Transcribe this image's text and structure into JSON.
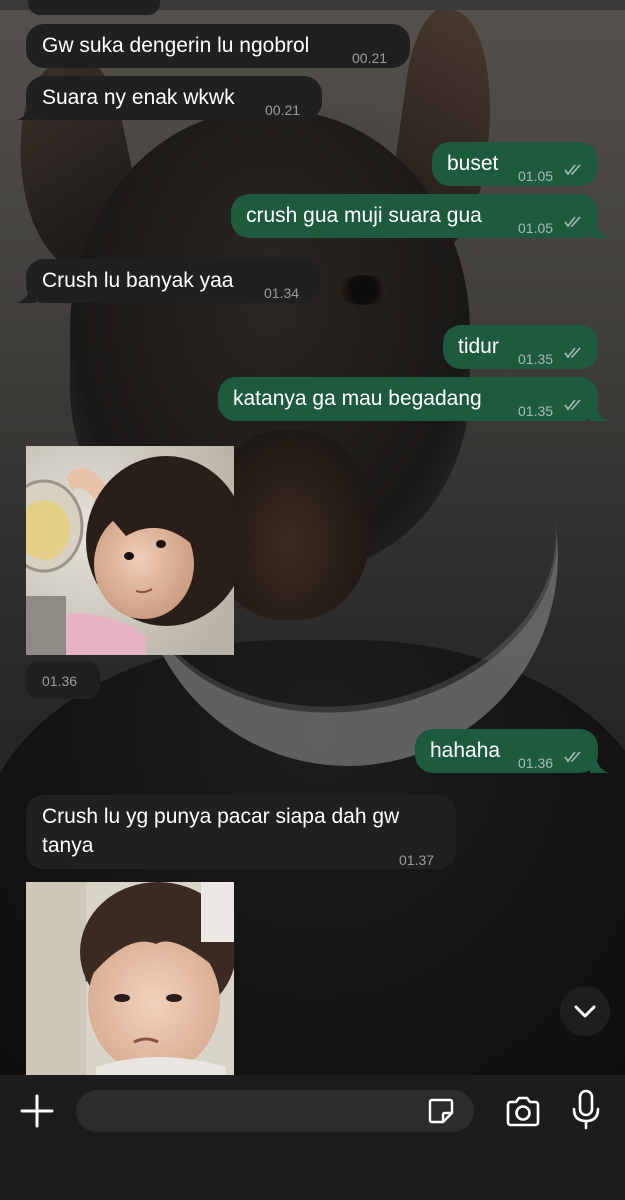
{
  "chat": {
    "messages": [
      {
        "direction": "in",
        "text": "Gw suka dengerin lu ngobrol",
        "time": "00.21"
      },
      {
        "direction": "in",
        "text": "Suara ny enak wkwk",
        "time": "00.21"
      },
      {
        "direction": "out",
        "text": "buset",
        "time": "01.05",
        "status": "read"
      },
      {
        "direction": "out",
        "text": "crush gua muji suara gua",
        "time": "01.05",
        "status": "read"
      },
      {
        "direction": "in",
        "text": "Crush lu banyak yaa",
        "time": "01.34"
      },
      {
        "direction": "out",
        "text": "tidur",
        "time": "01.35",
        "status": "read"
      },
      {
        "direction": "out",
        "text": "katanya ga mau begadang",
        "time": "01.35",
        "status": "read"
      },
      {
        "direction": "in",
        "type": "photo",
        "time": "01.36"
      },
      {
        "direction": "out",
        "text": "hahaha",
        "time": "01.36",
        "status": "read"
      },
      {
        "direction": "in",
        "text_line1": "Crush lu yg punya pacar siapa dah gw",
        "text_line2": "tanya",
        "time": "01.37"
      },
      {
        "direction": "in",
        "type": "photo"
      }
    ]
  },
  "icons": {
    "read_ticks": "double-check-icon",
    "scroll_down": "chevron-down-icon",
    "attach": "plus-icon",
    "sticker": "sticker-icon",
    "camera": "camera-icon",
    "mic": "microphone-icon"
  },
  "colors": {
    "incoming_bubble": "#202020",
    "outgoing_bubble": "#1e5a3e",
    "composer_bg": "#1c1c1e"
  }
}
